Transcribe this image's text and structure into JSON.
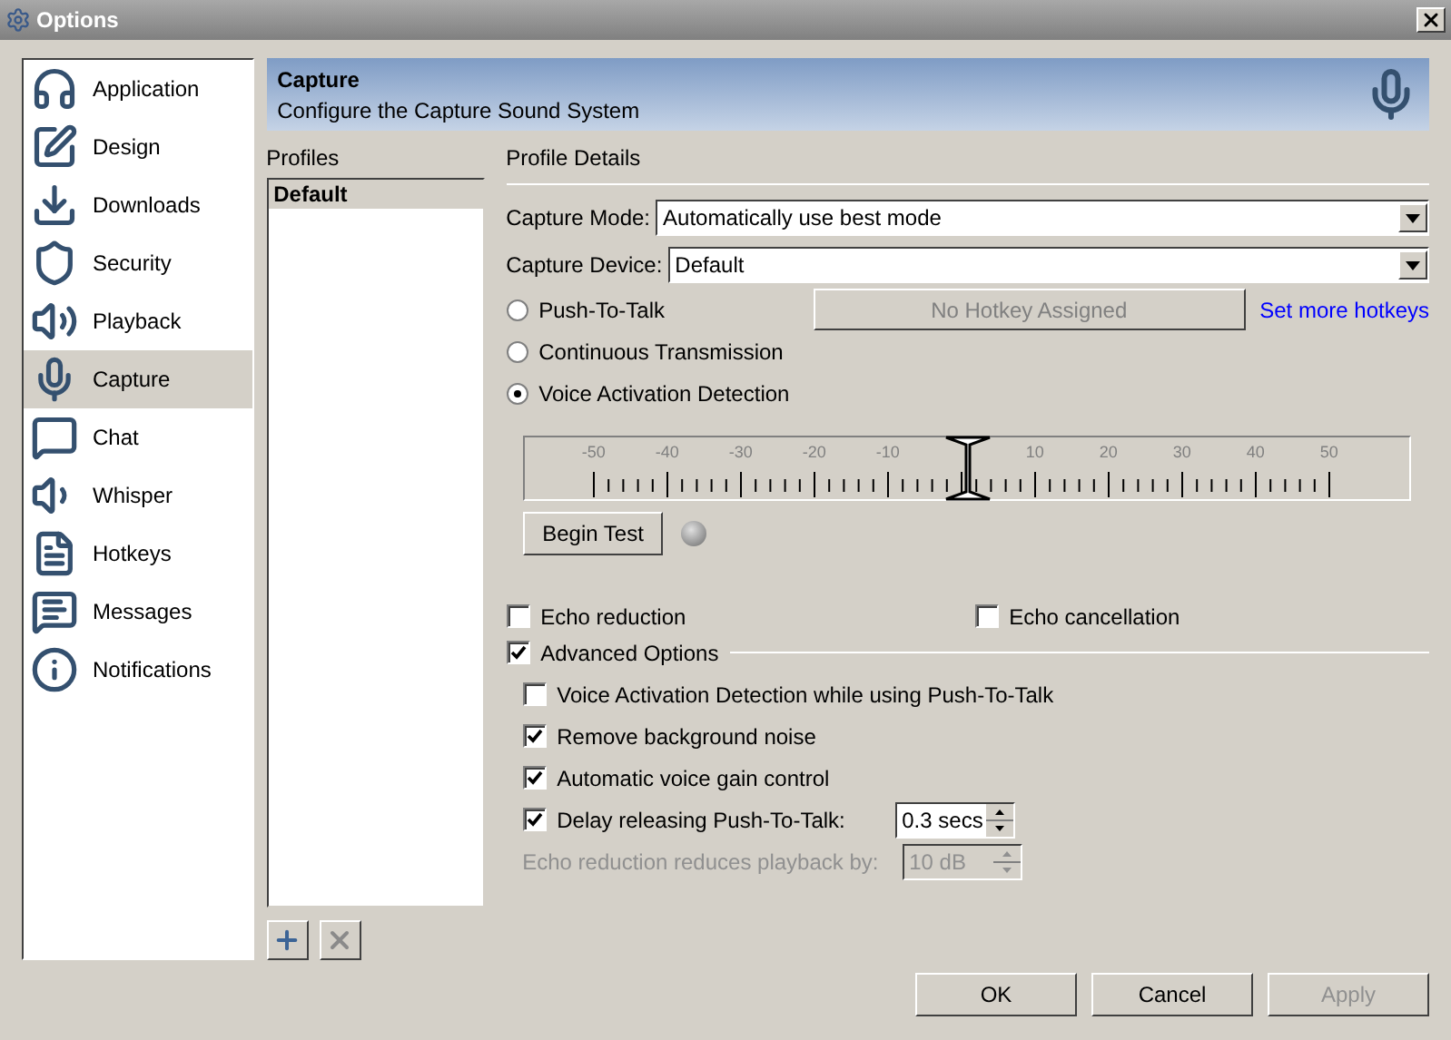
{
  "window": {
    "title": "Options"
  },
  "sidebar": {
    "items": [
      {
        "label": "Application",
        "selected": false
      },
      {
        "label": "Design",
        "selected": false
      },
      {
        "label": "Downloads",
        "selected": false
      },
      {
        "label": "Security",
        "selected": false
      },
      {
        "label": "Playback",
        "selected": false
      },
      {
        "label": "Capture",
        "selected": true
      },
      {
        "label": "Chat",
        "selected": false
      },
      {
        "label": "Whisper",
        "selected": false
      },
      {
        "label": "Hotkeys",
        "selected": false
      },
      {
        "label": "Messages",
        "selected": false
      },
      {
        "label": "Notifications",
        "selected": false
      }
    ]
  },
  "header": {
    "title": "Capture",
    "subtitle": "Configure the Capture Sound System"
  },
  "profiles": {
    "label": "Profiles",
    "items": [
      {
        "label": "Default",
        "selected": true
      }
    ]
  },
  "details": {
    "label": "Profile Details",
    "fields": [
      {
        "label": "Capture Mode:",
        "value": "Automatically use best mode"
      },
      {
        "label": "Capture Device:",
        "value": "Default"
      }
    ],
    "modes": [
      {
        "label": "Push-To-Talk",
        "selected": false
      },
      {
        "label": "Continuous Transmission",
        "selected": false
      },
      {
        "label": "Voice Activation Detection",
        "selected": true
      }
    ],
    "hotkey_button": {
      "label": "No Hotkey Assigned",
      "disabled": true
    },
    "hotkey_link": "Set more hotkeys",
    "vad_slider": {
      "ticks": [
        "-50",
        "-40",
        "-30",
        "-20",
        "-10",
        "10",
        "20",
        "30",
        "40",
        "50"
      ],
      "level": 0.51
    },
    "begin_test": "Begin Test",
    "test_indicator": {
      "on": false
    },
    "echo": [
      {
        "label": "Echo reduction",
        "checked": false
      },
      {
        "label": "Echo cancellation",
        "checked": false
      }
    ],
    "advanced": {
      "label": "Advanced Options",
      "checked": true,
      "options": [
        {
          "kind": "checkbox",
          "label": "Voice Activation Detection while using Push-To-Talk",
          "checked": false
        },
        {
          "kind": "checkbox",
          "label": "Remove background noise",
          "checked": true
        },
        {
          "kind": "checkbox",
          "label": "Automatic voice gain control",
          "checked": true
        },
        {
          "kind": "checkspin",
          "label": "Delay releasing Push-To-Talk:",
          "checked": true,
          "value": "0.3 secs",
          "disabled": false
        },
        {
          "kind": "spin",
          "label": "Echo reduction reduces playback by:",
          "value": "10 dB",
          "disabled": true
        }
      ]
    }
  },
  "buttons": [
    {
      "label": "OK",
      "disabled": false
    },
    {
      "label": "Cancel",
      "disabled": false
    },
    {
      "label": "Apply",
      "disabled": true
    }
  ]
}
